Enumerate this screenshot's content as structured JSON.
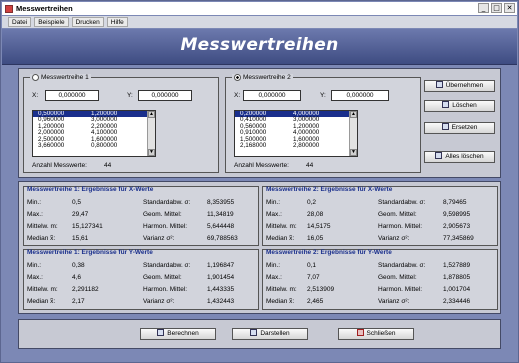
{
  "window": {
    "title": "Messwertreihen",
    "controls": [
      "_",
      "□",
      "✕"
    ]
  },
  "menu": {
    "items": [
      "Datei",
      "Beispiele",
      "Drucken",
      "Hilfe"
    ]
  },
  "header": {
    "title": "Messwertreihen"
  },
  "series1": {
    "label": "Messwertreihe 1",
    "x_label": "X:",
    "x_value": "0,000000",
    "y_label": "Y:",
    "y_value": "0,000000",
    "rows": [
      [
        "0,500000",
        "1,200000"
      ],
      [
        "0,960000",
        "3,000000"
      ],
      [
        "1,200000",
        "2,200000"
      ],
      [
        "2,000000",
        "4,100000"
      ],
      [
        "2,500000",
        "1,600000"
      ],
      [
        "3,660000",
        "0,800000"
      ]
    ],
    "count_label": "Anzahl Messwerte:",
    "count": "44"
  },
  "series2": {
    "label": "Messwertreihe 2",
    "x_label": "X:",
    "x_value": "0,000000",
    "y_label": "Y:",
    "y_value": "0,000000",
    "rows": [
      [
        "0,200000",
        "4,000000"
      ],
      [
        "0,410000",
        "3,000000"
      ],
      [
        "0,560000",
        "1,200000"
      ],
      [
        "0,910000",
        "4,000000"
      ],
      [
        "1,500000",
        "1,600000"
      ],
      [
        "2,168000",
        "2,800000"
      ]
    ],
    "count_label": "Anzahl Messwerte:",
    "count": "44"
  },
  "side_buttons": {
    "uebernehmen": "Übernehmen",
    "loeschen": "Löschen",
    "ersetzen": "Ersetzen",
    "alle_loeschen": "Alles löschen"
  },
  "results": {
    "r1x": {
      "title": "Messwertreihe 1:  Ergebnisse für X-Werte",
      "min_label": "Min.:",
      "min": "0,5",
      "max_label": "Max.:",
      "max": "29,47",
      "mean_label": "Mittelw. m:",
      "mean": "15,127341",
      "median_label": "Median x̃:",
      "median": "15,61",
      "sd_label": "Standardabw. σ:",
      "sd": "8,353955",
      "geo_label": "Geom. Mittel:",
      "geo": "11,34819",
      "harm_label": "Harmon. Mittel:",
      "harm": "5,644448",
      "var_label": "Varianz σ²:",
      "var": "69,788563"
    },
    "r2x": {
      "title": "Messwertreihe 2:  Ergebnisse für X-Werte",
      "min_label": "Min.:",
      "min": "0,2",
      "max_label": "Max.:",
      "max": "28,08",
      "mean_label": "Mittelw. m:",
      "mean": "14,5175",
      "median_label": "Median x̃:",
      "median": "16,05",
      "sd_label": "Standardabw. σ:",
      "sd": "8,79465",
      "geo_label": "Geom. Mittel:",
      "geo": "9,598995",
      "harm_label": "Harmon. Mittel:",
      "harm": "2,905673",
      "var_label": "Varianz σ²:",
      "var": "77,345869"
    },
    "r1y": {
      "title": "Messwertreihe 1:  Ergebnisse für Y-Werte",
      "min_label": "Min.:",
      "min": "0,38",
      "max_label": "Max.:",
      "max": "4,6",
      "mean_label": "Mittelw. m:",
      "mean": "2,291182",
      "median_label": "Median x̃:",
      "median": "2,17",
      "sd_label": "Standardabw. σ:",
      "sd": "1,196847",
      "geo_label": "Geom. Mittel:",
      "geo": "1,901454",
      "harm_label": "Harmon. Mittel:",
      "harm": "1,443335",
      "var_label": "Varianz σ²:",
      "var": "1,432443"
    },
    "r2y": {
      "title": "Messwertreihe 2:  Ergebnisse für Y-Werte",
      "min_label": "Min.:",
      "min": "0,1",
      "max_label": "Max.:",
      "max": "7,07",
      "mean_label": "Mittelw. m:",
      "mean": "2,513909",
      "median_label": "Median x̃:",
      "median": "2,465",
      "sd_label": "Standardabw. σ:",
      "sd": "1,527889",
      "geo_label": "Geom. Mittel:",
      "geo": "1,878805",
      "harm_label": "Harmon. Mittel:",
      "harm": "1,001704",
      "var_label": "Varianz σ²:",
      "var": "2,334446"
    }
  },
  "bottom_buttons": {
    "berechnen": "Berechnen",
    "darstellen": "Darstellen",
    "schliessen": "Schließen"
  }
}
